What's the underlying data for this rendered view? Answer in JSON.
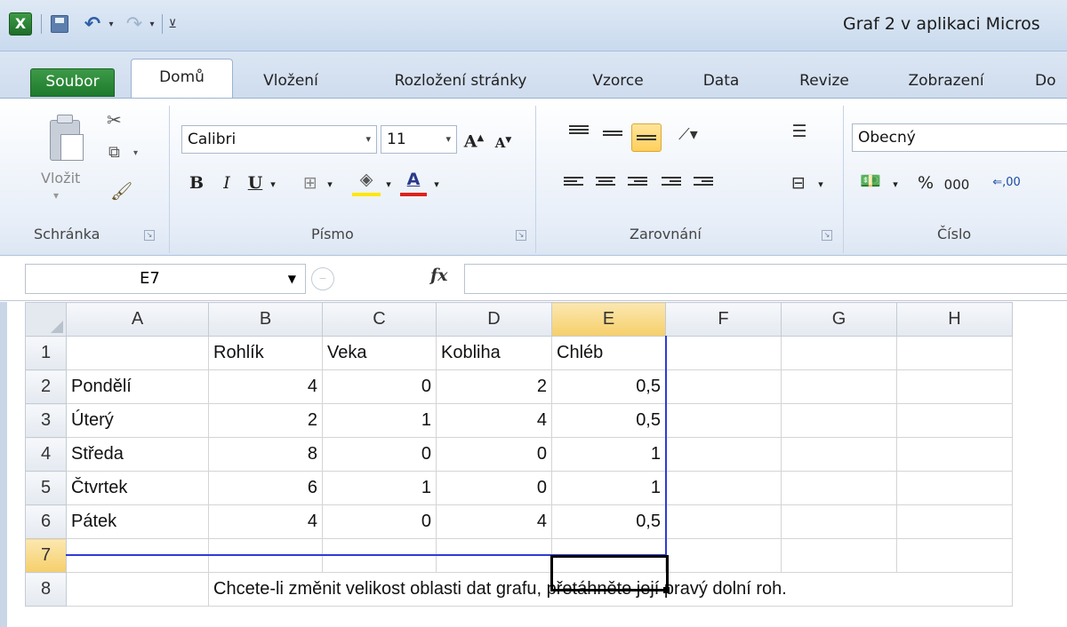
{
  "window": {
    "app_icon_letter": "X",
    "title": "Graf 2 v aplikaci Micros"
  },
  "tabs": [
    "Soubor",
    "Domů",
    "Vložení",
    "Rozložení stránky",
    "Vzorce",
    "Data",
    "Revize",
    "Zobrazení",
    "Do"
  ],
  "ribbon": {
    "clipboard": {
      "paste_label": "Vložit",
      "group_label": "Schránka"
    },
    "font": {
      "name": "Calibri",
      "size": "11",
      "bold": "B",
      "italic": "I",
      "underline": "U",
      "grow": "A",
      "shrink": "A",
      "color_a": "A",
      "group_label": "Písmo"
    },
    "alignment": {
      "group_label": "Zarovnání"
    },
    "number": {
      "format": "Obecný",
      "percent": "%",
      "thousands": "000",
      "group_label": "Číslo"
    }
  },
  "formula_bar": {
    "name_box": "E7",
    "fx": "fx",
    "value": ""
  },
  "colors": {
    "file_tab": "#2a8a37",
    "range_border": "#2f3bd8",
    "selected_header": "#f6cf6a"
  },
  "sheet": {
    "columns": [
      "A",
      "B",
      "C",
      "D",
      "E",
      "F",
      "G",
      "H"
    ],
    "selected_column": "E",
    "selected_row": "7",
    "rows": [
      {
        "n": "1",
        "cells": [
          "",
          "Rohlík",
          "Veka",
          "Kobliha",
          "Chléb",
          "",
          "",
          ""
        ]
      },
      {
        "n": "2",
        "cells": [
          "Pondělí",
          "4",
          "0",
          "2",
          "0,5",
          "",
          "",
          ""
        ]
      },
      {
        "n": "3",
        "cells": [
          "Úterý",
          "2",
          "1",
          "4",
          "0,5",
          "",
          "",
          ""
        ]
      },
      {
        "n": "4",
        "cells": [
          "Středa",
          "8",
          "0",
          "0",
          "1",
          "",
          "",
          ""
        ]
      },
      {
        "n": "5",
        "cells": [
          "Čtvrtek",
          "6",
          "1",
          "0",
          "1",
          "",
          "",
          ""
        ]
      },
      {
        "n": "6",
        "cells": [
          "Pátek",
          "4",
          "0",
          "4",
          "0,5",
          "",
          "",
          ""
        ]
      },
      {
        "n": "7",
        "cells": [
          "",
          "",
          "",
          "",
          "",
          "",
          "",
          ""
        ]
      }
    ],
    "row8": {
      "n": "8",
      "note": "Chcete-li změnit velikost oblasti dat grafu, přetáhněte její pravý dolní roh."
    }
  }
}
